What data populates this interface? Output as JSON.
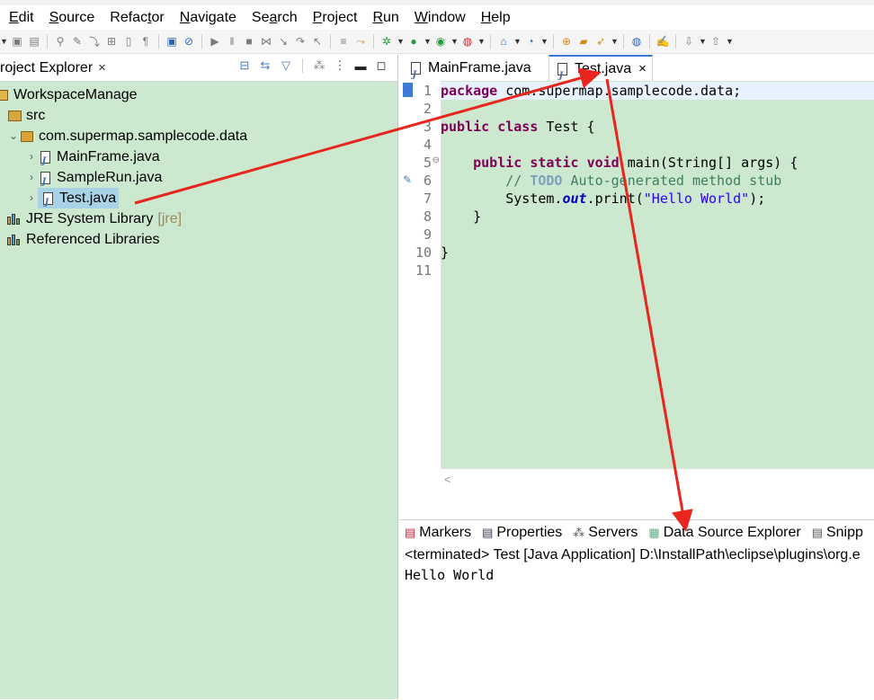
{
  "menubar": {
    "items": [
      {
        "acc": "E",
        "rest": "dit"
      },
      {
        "acc": "S",
        "rest": "ource"
      },
      {
        "pre": "Refac",
        "acc": "t",
        "rest": "or"
      },
      {
        "acc": "N",
        "rest": "avigate"
      },
      {
        "pre": "Se",
        "acc": "a",
        "rest": "rch"
      },
      {
        "acc": "P",
        "rest": "roject"
      },
      {
        "acc": "R",
        "rest": "un"
      },
      {
        "acc": "W",
        "rest": "indow"
      },
      {
        "acc": "H",
        "rest": "elp"
      }
    ]
  },
  "project_explorer": {
    "tab_label": "roject Explorer",
    "close": "×",
    "tree": {
      "project": "WorkspaceManage",
      "src": "src",
      "package": "com.supermap.samplecode.data",
      "files": [
        "MainFrame.java",
        "SampleRun.java",
        "Test.java"
      ],
      "jre_label": "JRE System Library",
      "jre_suffix": "[jre]",
      "ref_libs": "Referenced Libraries"
    }
  },
  "editor": {
    "tabs": [
      {
        "label": "MainFrame.java"
      },
      {
        "label": "Test.java",
        "close": "×"
      }
    ],
    "line_numbers": [
      "1",
      "2",
      "3",
      "4",
      "5",
      "6",
      "7",
      "8",
      "9",
      "10",
      "11"
    ],
    "code": {
      "l1_kw": "package",
      "l1_rest": " com.supermap.samplecode.data;",
      "l3_kw1": "public",
      "l3_kw2": "class",
      "l3_rest": " Test {",
      "l5_indent": "    ",
      "l5_kw1": "public",
      "l5_kw2": "static",
      "l5_kw3": "void",
      "l5_rest": " main(String[] args) {",
      "l6_indent": "        ",
      "l6_comment_start": "// ",
      "l6_todo": "TODO",
      "l6_comment_rest": " Auto-generated method stub",
      "l7_indent": "        ",
      "l7_pre": "System.",
      "l7_field": "out",
      "l7_mid": ".print(",
      "l7_str": "\"Hello World\"",
      "l7_end": ");",
      "l8": "    }",
      "l10": "}"
    }
  },
  "console": {
    "tabs": [
      "Markers",
      "Properties",
      "Servers",
      "Data Source Explorer",
      "Snipp"
    ],
    "status": "<terminated> Test [Java Application] D:\\InstallPath\\eclipse\\plugins\\org.e",
    "output": "Hello World"
  },
  "colors": {
    "arrow": "#e8261e",
    "panel_bg": "#cce8cf",
    "keyword": "#7f0055",
    "string": "#2a00ff",
    "comment": "#3f7f5f"
  }
}
